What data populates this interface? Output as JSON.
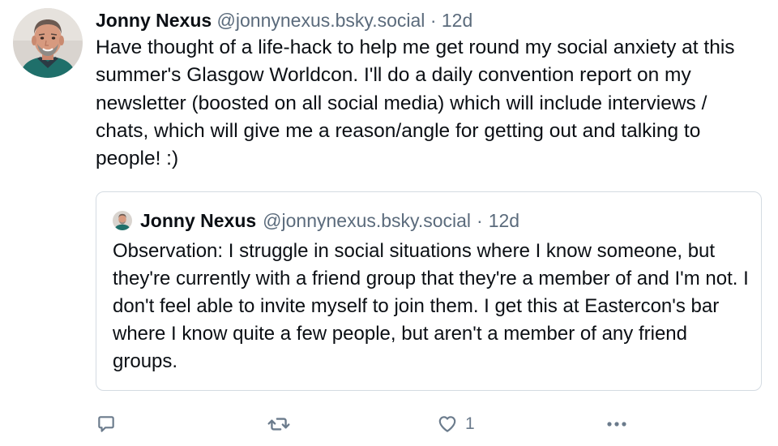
{
  "post": {
    "author_name": "Jonny Nexus",
    "author_handle": "@jonnynexus.bsky.social",
    "separator": "·",
    "timestamp": "12d",
    "text": "Have thought of a life-hack to help me get round my social anxiety at this summer's Glasgow Worldcon. I'll do a daily convention report on my newsletter (boosted on all social media) which will include interviews / chats, which will give me a reason/angle for getting out and talking to people! :)"
  },
  "quote": {
    "author_name": "Jonny Nexus",
    "author_handle": "@jonnynexus.bsky.social",
    "separator": "·",
    "timestamp": "12d",
    "text": "Observation: I struggle in social situations where I know someone, but they're currently with a friend group that they're a member of and I'm not. I don't feel able to invite myself to join them. I get this at Eastercon's bar where I know quite a few people, but aren't a member of any friend groups."
  },
  "actions": {
    "reply_icon": "reply-icon",
    "repost_icon": "repost-icon",
    "like_icon": "heart-icon",
    "like_count": "1",
    "more_icon": "more-options-icon"
  },
  "colors": {
    "text": "#0b0f14",
    "muted": "#5b6b7c",
    "border": "#d4dbe2",
    "icon": "#6b7b8c"
  }
}
